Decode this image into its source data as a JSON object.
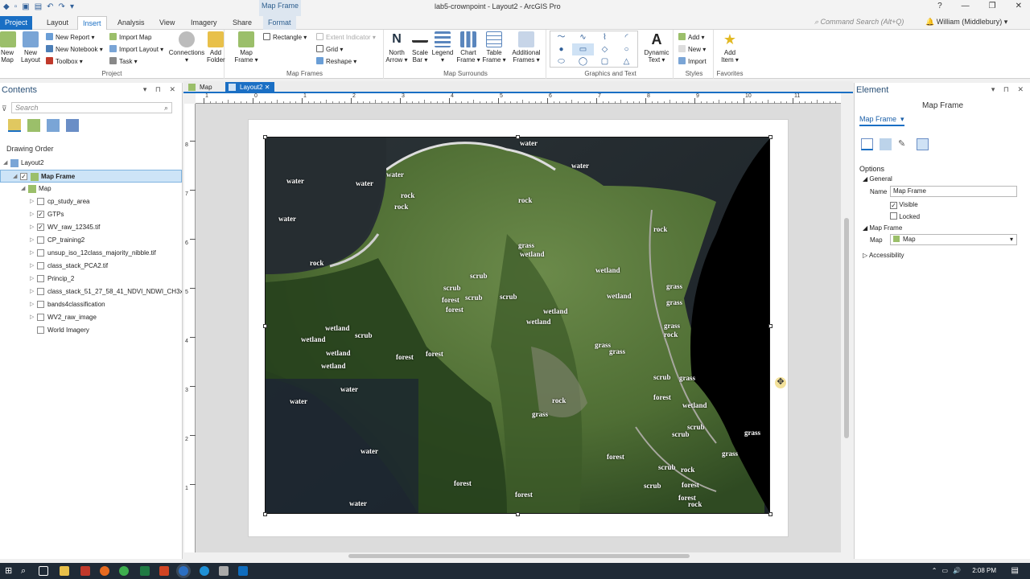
{
  "window": {
    "title": "lab5-crownpoint - Layout2 - ArcGIS Pro",
    "context_tab_group": "Map Frame",
    "command_search_placeholder": "Command Search (Alt+Q)",
    "user": "William (Middlebury)"
  },
  "ribbon_tabs": [
    "Project",
    "Layout",
    "Insert",
    "Analysis",
    "View",
    "Imagery",
    "Share",
    "Format"
  ],
  "active_tab": "Insert",
  "ribbon": {
    "project": {
      "label": "Project",
      "new_map": "New Map",
      "new_layout": "New Layout",
      "new_report": "New Report",
      "new_notebook": "New Notebook",
      "toolbox": "Toolbox",
      "import_map": "Import Map",
      "import_layout": "Import Layout",
      "task": "Task",
      "connections": "Connections",
      "add_folder": "Add Folder"
    },
    "map_frames": {
      "label": "Map Frames",
      "map_frame": "Map Frame",
      "rectangle": "Rectangle",
      "extent_indicator": "Extent Indicator",
      "grid": "Grid",
      "reshape": "Reshape"
    },
    "map_surrounds": {
      "label": "Map Surrounds",
      "north_arrow": "North Arrow",
      "scale_bar": "Scale Bar",
      "legend": "Legend",
      "chart_frame": "Chart Frame",
      "table_frame": "Table Frame",
      "additional_frames": "Additional Frames"
    },
    "graphics": {
      "label": "Graphics and Text",
      "dynamic_text": "Dynamic Text"
    },
    "styles": {
      "label": "Styles",
      "add": "Add",
      "new": "New",
      "import": "Import"
    },
    "favorites": {
      "label": "Favorites",
      "add_item": "Add Item"
    }
  },
  "contents": {
    "title": "Contents",
    "search_placeholder": "Search",
    "drawing_order": "Drawing Order",
    "items": [
      {
        "label": "Layout2",
        "indent": 0,
        "checkbox": "none",
        "expanded": true
      },
      {
        "label": "Map Frame",
        "indent": 1,
        "checkbox": "checked",
        "expanded": true,
        "selected": true
      },
      {
        "label": "Map",
        "indent": 2,
        "checkbox": "none",
        "expanded": true
      },
      {
        "label": "cp_study_area",
        "indent": 3,
        "checkbox": "unchecked",
        "expanded": false
      },
      {
        "label": "GTPs",
        "indent": 3,
        "checkbox": "checked",
        "expanded": false
      },
      {
        "label": "WV_raw_12345.tif",
        "indent": 3,
        "checkbox": "checked",
        "expanded": false
      },
      {
        "label": "CP_training2",
        "indent": 3,
        "checkbox": "unchecked",
        "expanded": false
      },
      {
        "label": "unsup_iso_12class_majority_nibble.tif",
        "indent": 3,
        "checkbox": "unchecked",
        "expanded": false
      },
      {
        "label": "class_stack_PCA2.tif",
        "indent": 3,
        "checkbox": "unchecked",
        "expanded": false
      },
      {
        "label": "Princip_2",
        "indent": 3,
        "checkbox": "unchecked",
        "expanded": false
      },
      {
        "label": "class_stack_51_27_58_41_NDVI_NDWI_CH3x3norm",
        "indent": 3,
        "checkbox": "unchecked",
        "expanded": false
      },
      {
        "label": "bands4classification",
        "indent": 3,
        "checkbox": "unchecked",
        "expanded": false
      },
      {
        "label": "WV2_raw_image",
        "indent": 3,
        "checkbox": "unchecked",
        "expanded": false
      },
      {
        "label": "World Imagery",
        "indent": 3,
        "checkbox": "unchecked",
        "expanded": null
      }
    ]
  },
  "view_tabs": [
    {
      "label": "Map",
      "active": false
    },
    {
      "label": "Layout2",
      "active": true
    }
  ],
  "ruler_top": [
    "1",
    "0",
    "1",
    "2",
    "3",
    "4",
    "5",
    "6",
    "7",
    "8",
    "9",
    "10",
    "11"
  ],
  "ruler_left": [
    "8",
    "7",
    "6",
    "5",
    "4",
    "3",
    "2",
    "1"
  ],
  "map_labels": [
    [
      "water",
      646,
      178
    ],
    [
      "water",
      710,
      206
    ],
    [
      "water",
      356,
      225
    ],
    [
      "water",
      442,
      228
    ],
    [
      "water",
      480,
      217
    ],
    [
      "rock",
      498,
      243
    ],
    [
      "rock",
      490,
      257
    ],
    [
      "water",
      346,
      272
    ],
    [
      "rock",
      644,
      249
    ],
    [
      "rock",
      812,
      285
    ],
    [
      "rock",
      385,
      327
    ],
    [
      "grass",
      644,
      305
    ],
    [
      "wetland",
      646,
      316
    ],
    [
      "wetland",
      740,
      336
    ],
    [
      "scrub",
      584,
      343
    ],
    [
      "scrub",
      551,
      358
    ],
    [
      "forest",
      549,
      373
    ],
    [
      "scrub",
      578,
      370
    ],
    [
      "scrub",
      621,
      369
    ],
    [
      "forest",
      554,
      385
    ],
    [
      "wetland",
      754,
      368
    ],
    [
      "grass",
      828,
      356
    ],
    [
      "grass",
      828,
      376
    ],
    [
      "wetland",
      675,
      387
    ],
    [
      "wetland",
      654,
      400
    ],
    [
      "grass",
      825,
      405
    ],
    [
      "rock",
      825,
      416
    ],
    [
      "wetland",
      404,
      408
    ],
    [
      "wetland",
      374,
      422
    ],
    [
      "scrub",
      441,
      417
    ],
    [
      "wetland",
      405,
      439
    ],
    [
      "wetland",
      399,
      455
    ],
    [
      "forest",
      492,
      444
    ],
    [
      "forest",
      529,
      440
    ],
    [
      "grass",
      739,
      429
    ],
    [
      "grass",
      757,
      437
    ],
    [
      "scrub",
      812,
      469
    ],
    [
      "grass",
      844,
      470
    ],
    [
      "forest",
      812,
      494
    ],
    [
      "wetland",
      848,
      504
    ],
    [
      "water",
      423,
      484
    ],
    [
      "water",
      360,
      499
    ],
    [
      "rock",
      686,
      498
    ],
    [
      "grass",
      661,
      515
    ],
    [
      "scrub",
      854,
      531
    ],
    [
      "scrub",
      835,
      540
    ],
    [
      "grass",
      925,
      538
    ],
    [
      "water",
      448,
      561
    ],
    [
      "grass",
      897,
      564
    ],
    [
      "forest",
      754,
      568
    ],
    [
      "scrub",
      818,
      581
    ],
    [
      "rock",
      846,
      584
    ],
    [
      "forest",
      564,
      601
    ],
    [
      "scrub",
      800,
      604
    ],
    [
      "forest",
      847,
      603
    ],
    [
      "forest",
      640,
      615
    ],
    [
      "forest",
      843,
      619
    ],
    [
      "rock",
      855,
      627
    ],
    [
      "water",
      434,
      626
    ]
  ],
  "element": {
    "title": "Element",
    "heading": "Map Frame",
    "dropdown": "Map Frame",
    "options": "Options",
    "general": "General",
    "name_label": "Name",
    "name_value": "Map Frame",
    "visible": "Visible",
    "locked": "Locked",
    "map_frame_section": "Map Frame",
    "map_label": "Map",
    "map_value": "Map",
    "accessibility": "Accessibility"
  },
  "taskbar": {
    "time": "2:08 PM"
  }
}
